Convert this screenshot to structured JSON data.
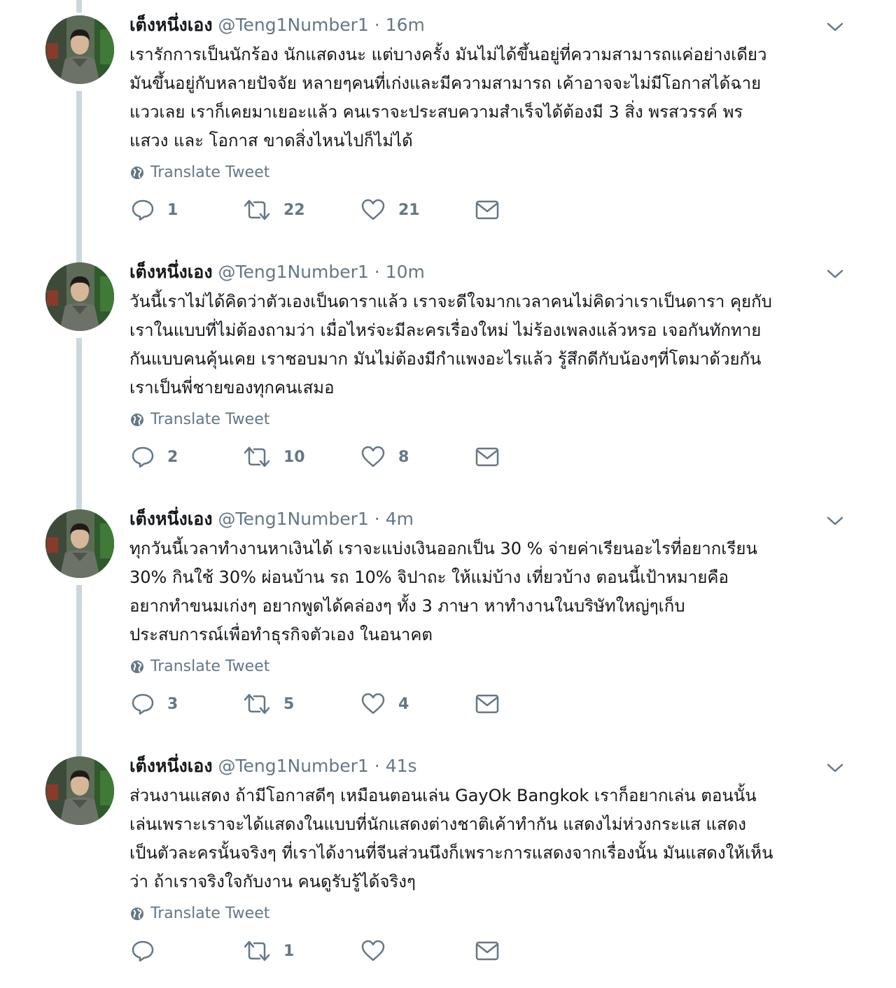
{
  "colors": {
    "text": "#14171a",
    "muted": "#657786",
    "thread_line": "#ccd6dd"
  },
  "tweets": [
    {
      "name": "เต็งหนึ่งเอง",
      "handle": "@Teng1Number1",
      "separator": "·",
      "time": "16m",
      "text": "เรารักการเป็นนักร้อง นักแสดงนะ แต่บางครั้ง มันไม่ได้ขึ้นอยู่ที่ความสามารถแค่อย่างเดียว\nมันขึ้นอยู่กับหลายปัจจัย หลายๆคนที่เก่งและมีความสามารถ เค้าอาจจะไม่มีโอกาสได้ฉาย\nแววเลย เราก็เคยมาเยอะแล้ว คนเราจะประสบความสำเร็จได้ต้องมี 3 สิ่ง พรสวรรค์ พร\nแสวง และ โอกาส ขาดสิ่งไหนไปก็ไม่ได้",
      "translate_label": "Translate Tweet",
      "replies": "1",
      "retweets": "22",
      "likes": "21"
    },
    {
      "name": "เต็งหนึ่งเอง",
      "handle": "@Teng1Number1",
      "separator": "·",
      "time": "10m",
      "text": "วันนี้เราไม่ได้คิดว่าตัวเองเป็นดาราแล้ว เราจะดีใจมากเวลาคนไม่คิดว่าเราเป็นดารา คุยกับ\nเราในแบบที่ไม่ต้องถามว่า เมื่อไหร่จะมีละครเรื่องใหม่ ไม่ร้องเพลงแล้วหรอ เจอกันทักทาย\nกันแบบคนคุ้นเคย เราชอบมาก มันไม่ต้องมีกำแพงอะไรแล้ว รู้สึกดีกับน้องๆที่โตมาด้วยกัน\nเราเป็นพี่ชายของทุกคนเสมอ",
      "translate_label": "Translate Tweet",
      "replies": "2",
      "retweets": "10",
      "likes": "8"
    },
    {
      "name": "เต็งหนึ่งเอง",
      "handle": "@Teng1Number1",
      "separator": "·",
      "time": "4m",
      "text": "ทุกวันนี้เวลาทำงานหาเงินได้ เราจะแบ่งเงินออกเป็น 30 % จ่ายค่าเรียนอะไรที่อยากเรียน\n30% กินใช้ 30% ผ่อนบ้าน รถ  10% จิปาถะ ให้แม่บ้าง เที่ยวบ้าง ตอนนี้เป้าหมายคือ\nอยากทำขนมเก่งๆ อยากพูดได้คล่องๆ ทั้ง 3 ภาษา หาทำงานในบริษัทใหญ่ๆเก็บ\nประสบการณ์เพื่อทำธุรกิจตัวเอง ในอนาคต",
      "translate_label": "Translate Tweet",
      "replies": "3",
      "retweets": "5",
      "likes": "4"
    },
    {
      "name": "เต็งหนึ่งเอง",
      "handle": "@Teng1Number1",
      "separator": "·",
      "time": "41s",
      "text": "ส่วนงานแสดง ถ้ามีโอกาสดีๆ เหมือนตอนเล่น GayOk Bangkok เราก็อยากเล่น ตอนนั้น\nเล่นเพราะเราจะได้แสดงในแบบที่นักแสดงต่างชาติเค้าทำกัน แสดงไม่ห่วงกระแส แสดง\nเป็นตัวละครนั้นจริงๆ ที่เราได้งานที่จีนส่วนนึงก็เพราะการแสดงจากเรื่องนั้น มันแสดงให้เห็น\nว่า ถ้าเราจริงใจกับงาน คนดูรับรู้ได้จริงๆ",
      "translate_label": "Translate Tweet",
      "replies": "",
      "retweets": "1",
      "likes": ""
    }
  ]
}
